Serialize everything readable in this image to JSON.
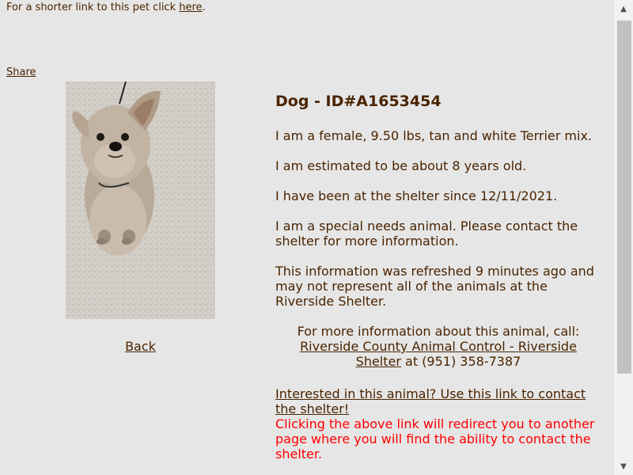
{
  "top": {
    "prefix": "For a shorter link to this pet click ",
    "link": "here",
    "suffix": "."
  },
  "share": "Share",
  "back": "Back",
  "pet": {
    "title": "Dog - ID#A1653454",
    "desc": "I am a female, 9.50 lbs, tan and white Terrier mix.",
    "age": "I am estimated to be about 8 years old.",
    "since": "I have been at the shelter since 12/11/2021.",
    "special": "I am a special needs animal. Please contact the shelter for more information.",
    "refresh": "This information was refreshed 9 minutes ago and may not represent all of the animals at the Riverside Shelter."
  },
  "contact": {
    "lead": "For more information about this animal, call:",
    "shelter_link": "Riverside County Animal Control - Riverside Shelter",
    "phone": " at (951) 358-7387"
  },
  "interest": {
    "link": "Interested in this animal? Use this link to contact the shelter!",
    "note": "Clicking the above link will redirect you to another page where you will find the ability to contact the shelter."
  },
  "icons": {
    "scroll_up": "triangle-up-icon",
    "scroll_down": "triangle-down-icon"
  },
  "colors": {
    "text": "#4a2400",
    "background": "#e6e6e6",
    "warning": "#ff0000"
  }
}
